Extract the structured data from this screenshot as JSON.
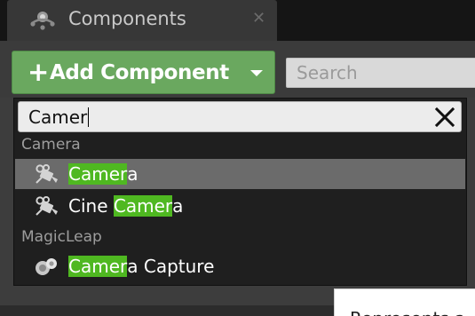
{
  "tab": {
    "title": "Components",
    "icon": "components-icon",
    "close_label": "✕"
  },
  "toolbar": {
    "add_icon": "plus-icon",
    "add_plus": "+",
    "add_label": "Add Component",
    "add_caret_icon": "chevron-down-icon",
    "search_placeholder": "Search",
    "search_value": ""
  },
  "dropdown": {
    "filter_value": "Camer",
    "clear_icon": "close-icon",
    "groups": [
      {
        "category": "Camera",
        "items": [
          {
            "icon": "camera-icon",
            "selected": true,
            "parts": [
              {
                "text": "Camer",
                "hl": true
              },
              {
                "text": "a",
                "hl": false
              }
            ]
          },
          {
            "icon": "camera-icon",
            "selected": false,
            "parts": [
              {
                "text": "Cine ",
                "hl": false
              },
              {
                "text": "Camer",
                "hl": true
              },
              {
                "text": "a",
                "hl": false
              }
            ]
          }
        ]
      },
      {
        "category": "MagicLeap",
        "items": [
          {
            "icon": "scene-capture-icon",
            "selected": false,
            "parts": [
              {
                "text": "Camer",
                "hl": true
              },
              {
                "text": "a Capture",
                "hl": false
              }
            ]
          }
        ]
      }
    ]
  },
  "tooltip": {
    "text": "Represents a"
  },
  "colors": {
    "add_button": "#6aa85f",
    "highlight": "#4fb821",
    "selected_row": "#6b6b6b",
    "menu_bg": "#1f1f1f"
  }
}
